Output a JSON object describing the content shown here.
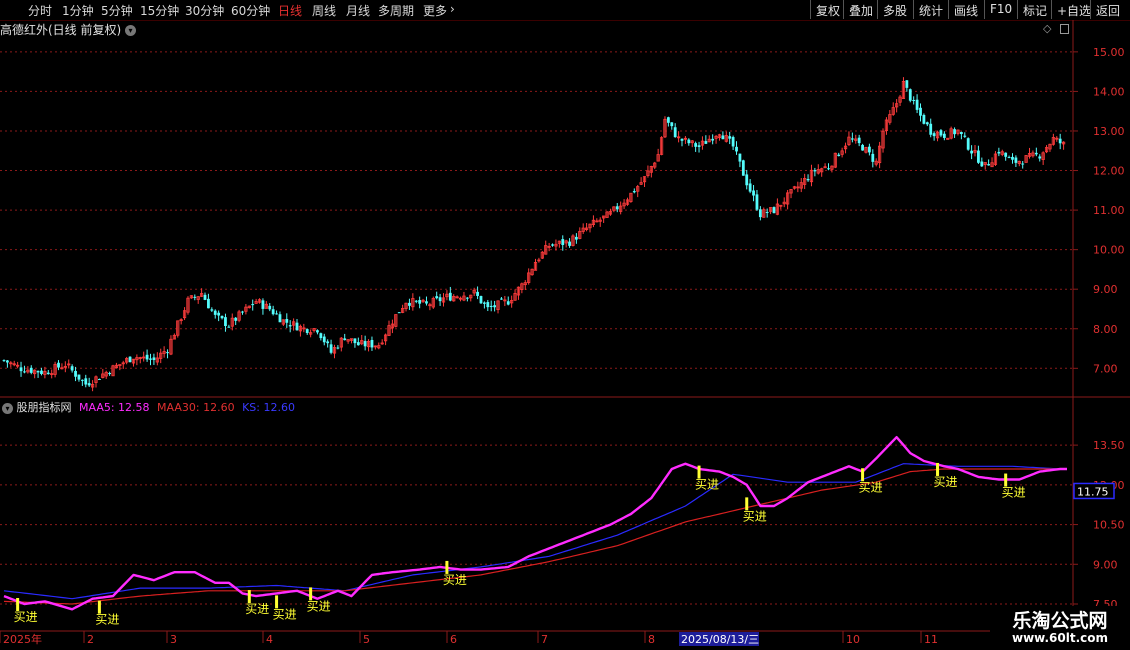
{
  "toolbar": {
    "periods": [
      "分时",
      "1分钟",
      "5分钟",
      "15分钟",
      "30分钟",
      "60分钟",
      "日线",
      "周线",
      "月线",
      "多周期",
      "更多"
    ],
    "active_period": "日线",
    "right_buttons": [
      "复权",
      "叠加",
      "多股",
      "统计",
      "画线",
      "F10",
      "标记",
      "+自选",
      "返回"
    ]
  },
  "stock_title": "高德红外(日线 前复权)",
  "indicator": {
    "name": "股朋指标网",
    "maa5_label": "MAA5: 12.58",
    "maa30_label": "MAA30: 12.60",
    "ks_label": "KS: 12.60",
    "current_value_box": "11.75",
    "signal_label": "买进"
  },
  "x_axis": {
    "ticks": [
      "2025年",
      "2",
      "3",
      "4",
      "5",
      "6",
      "7",
      "8",
      "10",
      "11"
    ],
    "highlight_label": "2025/08/13/三"
  },
  "colors": {
    "up": "#ff3c3c",
    "down": "#54fcfc",
    "maa5": "#ff2cff",
    "maa30": "#d82020",
    "ks": "#2a2aff",
    "signal": "#ffff33",
    "grid": "#8b1a1a"
  },
  "watermark": {
    "line1": "乐淘公式网",
    "line2": "www.60lt.com"
  },
  "chart_data": [
    {
      "type": "candlestick",
      "ylim": [
        6.3,
        15.3
      ],
      "y_ticks": [
        "15.00",
        "14.00",
        "13.00",
        "12.00",
        "11.00",
        "10.00",
        "9.00",
        "8.00",
        "7.00"
      ],
      "close_path": [
        [
          0,
          7.2
        ],
        [
          5,
          7.0
        ],
        [
          12,
          6.9
        ],
        [
          18,
          7.1
        ],
        [
          24,
          6.6
        ],
        [
          30,
          6.9
        ],
        [
          38,
          7.3
        ],
        [
          44,
          7.2
        ],
        [
          48,
          7.5
        ],
        [
          54,
          8.7
        ],
        [
          58,
          8.9
        ],
        [
          62,
          8.3
        ],
        [
          66,
          8.1
        ],
        [
          70,
          8.4
        ],
        [
          74,
          8.7
        ],
        [
          78,
          8.5
        ],
        [
          82,
          8.2
        ],
        [
          88,
          8.0
        ],
        [
          92,
          8.0
        ],
        [
          96,
          7.4
        ],
        [
          100,
          7.8
        ],
        [
          104,
          7.6
        ],
        [
          110,
          7.6
        ],
        [
          114,
          8.2
        ],
        [
          118,
          8.7
        ],
        [
          124,
          8.6
        ],
        [
          130,
          8.8
        ],
        [
          138,
          8.9
        ],
        [
          142,
          8.5
        ],
        [
          148,
          8.7
        ],
        [
          152,
          9.1
        ],
        [
          156,
          9.7
        ],
        [
          160,
          10.1
        ],
        [
          166,
          10.2
        ],
        [
          172,
          10.6
        ],
        [
          178,
          10.9
        ],
        [
          184,
          11.4
        ],
        [
          188,
          11.8
        ],
        [
          192,
          12.4
        ],
        [
          194,
          13.3
        ],
        [
          198,
          12.8
        ],
        [
          204,
          12.6
        ],
        [
          210,
          13.0
        ],
        [
          214,
          12.6
        ],
        [
          218,
          11.7
        ],
        [
          222,
          10.9
        ],
        [
          226,
          11.0
        ],
        [
          232,
          11.5
        ],
        [
          238,
          12.0
        ],
        [
          242,
          12.1
        ],
        [
          248,
          12.8
        ],
        [
          252,
          12.6
        ],
        [
          256,
          12.2
        ],
        [
          258,
          13.0
        ],
        [
          262,
          13.7
        ],
        [
          264,
          14.2
        ],
        [
          268,
          13.5
        ],
        [
          272,
          13.0
        ],
        [
          276,
          12.9
        ],
        [
          280,
          13.0
        ],
        [
          284,
          12.5
        ],
        [
          288,
          12.1
        ],
        [
          292,
          12.5
        ],
        [
          296,
          12.2
        ],
        [
          300,
          12.3
        ],
        [
          304,
          12.4
        ],
        [
          308,
          12.8
        ],
        [
          312,
          12.6
        ]
      ],
      "sessions": 312
    },
    {
      "type": "line",
      "ylim": [
        7.5,
        14.6
      ],
      "y_ticks": [
        "13.50",
        "12.00",
        "10.50",
        "9.00",
        "7.50"
      ],
      "series": [
        {
          "name": "MAA5",
          "path": [
            [
              0,
              7.8
            ],
            [
              6,
              7.5
            ],
            [
              12,
              7.6
            ],
            [
              20,
              7.3
            ],
            [
              26,
              7.7
            ],
            [
              32,
              7.8
            ],
            [
              38,
              8.6
            ],
            [
              44,
              8.4
            ],
            [
              50,
              8.7
            ],
            [
              56,
              8.7
            ],
            [
              62,
              8.3
            ],
            [
              66,
              8.3
            ],
            [
              70,
              7.9
            ],
            [
              74,
              7.8
            ],
            [
              80,
              7.9
            ],
            [
              86,
              8.0
            ],
            [
              92,
              7.7
            ],
            [
              98,
              8.0
            ],
            [
              102,
              7.8
            ],
            [
              108,
              8.6
            ],
            [
              114,
              8.7
            ],
            [
              122,
              8.8
            ],
            [
              128,
              8.9
            ],
            [
              134,
              8.8
            ],
            [
              140,
              8.8
            ],
            [
              148,
              8.9
            ],
            [
              154,
              9.3
            ],
            [
              160,
              9.6
            ],
            [
              166,
              9.9
            ],
            [
              172,
              10.2
            ],
            [
              178,
              10.5
            ],
            [
              184,
              10.9
            ],
            [
              190,
              11.5
            ],
            [
              196,
              12.6
            ],
            [
              200,
              12.8
            ],
            [
              204,
              12.6
            ],
            [
              210,
              12.5
            ],
            [
              214,
              12.3
            ],
            [
              218,
              12.0
            ],
            [
              222,
              11.2
            ],
            [
              226,
              11.2
            ],
            [
              230,
              11.5
            ],
            [
              236,
              12.1
            ],
            [
              242,
              12.4
            ],
            [
              248,
              12.7
            ],
            [
              252,
              12.5
            ],
            [
              256,
              13.0
            ],
            [
              262,
              13.8
            ],
            [
              266,
              13.2
            ],
            [
              270,
              12.9
            ],
            [
              276,
              12.7
            ],
            [
              280,
              12.6
            ],
            [
              286,
              12.3
            ],
            [
              292,
              12.2
            ],
            [
              298,
              12.2
            ],
            [
              304,
              12.5
            ],
            [
              310,
              12.6
            ]
          ]
        },
        {
          "name": "MAA30",
          "path": [
            [
              0,
              7.6
            ],
            [
              20,
              7.5
            ],
            [
              40,
              7.8
            ],
            [
              60,
              8.0
            ],
            [
              80,
              8.0
            ],
            [
              100,
              8.0
            ],
            [
              120,
              8.3
            ],
            [
              140,
              8.6
            ],
            [
              160,
              9.1
            ],
            [
              180,
              9.7
            ],
            [
              200,
              10.6
            ],
            [
              220,
              11.2
            ],
            [
              240,
              11.8
            ],
            [
              256,
              12.1
            ],
            [
              266,
              12.5
            ],
            [
              276,
              12.6
            ],
            [
              290,
              12.6
            ],
            [
              310,
              12.6
            ]
          ]
        },
        {
          "name": "KS",
          "path": [
            [
              0,
              8.0
            ],
            [
              20,
              7.7
            ],
            [
              40,
              8.1
            ],
            [
              60,
              8.1
            ],
            [
              80,
              8.2
            ],
            [
              100,
              8.0
            ],
            [
              120,
              8.6
            ],
            [
              140,
              8.9
            ],
            [
              160,
              9.3
            ],
            [
              180,
              10.1
            ],
            [
              200,
              11.2
            ],
            [
              214,
              12.4
            ],
            [
              230,
              12.1
            ],
            [
              250,
              12.1
            ],
            [
              264,
              12.8
            ],
            [
              280,
              12.7
            ],
            [
              296,
              12.7
            ],
            [
              310,
              12.6
            ]
          ]
        }
      ],
      "signals": [
        [
          4,
          7.5
        ],
        [
          28,
          7.4
        ],
        [
          72,
          7.8
        ],
        [
          80,
          7.6
        ],
        [
          90,
          7.9
        ],
        [
          130,
          8.9
        ],
        [
          204,
          12.5
        ],
        [
          218,
          11.3
        ],
        [
          252,
          12.4
        ],
        [
          274,
          12.6
        ],
        [
          294,
          12.2
        ]
      ]
    }
  ]
}
